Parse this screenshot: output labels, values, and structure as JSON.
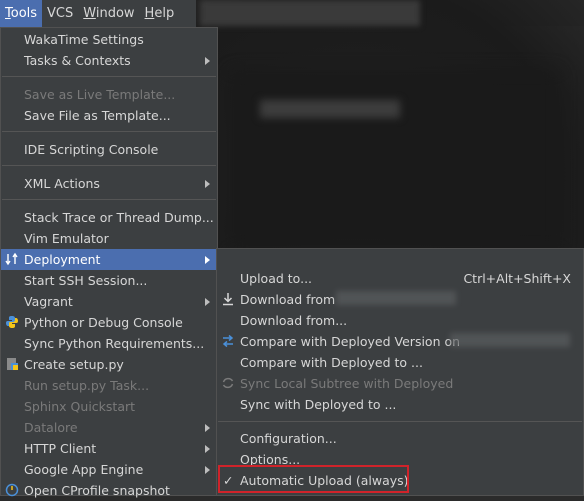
{
  "menubar": {
    "items": [
      {
        "label": "Tools",
        "mnemonic": "T",
        "rest": "ools",
        "active": true
      },
      {
        "label": "VCS",
        "mnemonic": "",
        "rest": "VCS",
        "active": false
      },
      {
        "label": "Window",
        "mnemonic": "W",
        "rest": "indow",
        "active": false
      },
      {
        "label": "Help",
        "mnemonic": "H",
        "rest": "elp",
        "active": false
      }
    ]
  },
  "tools_menu": {
    "wakatime": "WakaTime Settings",
    "tasks": "Tasks & Contexts",
    "save_live": "Save as Live Template...",
    "save_file": "Save File as Template...",
    "ide_scripting": "IDE Scripting Console",
    "xml_actions": "XML Actions",
    "stack_trace": "Stack Trace or Thread Dump...",
    "vim": "Vim Emulator",
    "deployment": "Deployment",
    "ssh": "Start SSH Session...",
    "vagrant": "Vagrant",
    "python_console": "Python or Debug Console",
    "sync_req": "Sync Python Requirements...",
    "create_setup": "Create setup.py",
    "run_setup": "Run setup.py Task...",
    "sphinx": "Sphinx Quickstart",
    "datalore": "Datalore",
    "http_client": "HTTP Client",
    "google_app": "Google App Engine",
    "cprofile": "Open CProfile snapshot"
  },
  "deploy_menu": {
    "upload_to": "Upload to...",
    "upload_shortcut": "Ctrl+Alt+Shift+X",
    "download_from_partial": "Download from",
    "download_from": "Download from...",
    "compare_version": "Compare with Deployed Version on",
    "compare_to": "Compare with Deployed to ...",
    "sync_local": "Sync Local Subtree with Deployed",
    "sync_with": "Sync with Deployed to ...",
    "configuration": "Configuration...",
    "options": "Options...",
    "auto_upload": "Automatic Upload (always)",
    "check_mark": "✓"
  },
  "colors": {
    "selection": "#4b6eaf",
    "highlight_box": "#d0232a"
  }
}
